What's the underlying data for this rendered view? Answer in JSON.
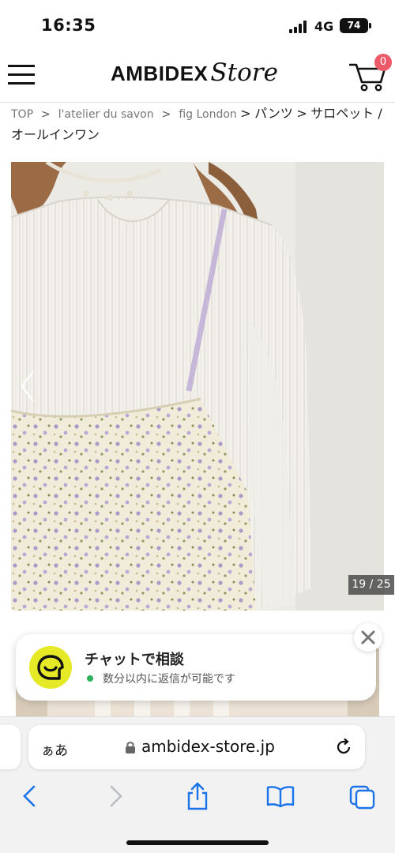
{
  "status_bar": {
    "time": "16:35",
    "network": "4G",
    "battery": "74"
  },
  "header": {
    "logo_main": "AMBIDEX",
    "logo_script": "Store",
    "cart_count": "0"
  },
  "breadcrumb": [
    {
      "label": "TOP"
    },
    {
      "label": "l'atelier du savon"
    },
    {
      "label": "fig London"
    },
    {
      "label": "パンツ"
    },
    {
      "label": "サロペット / オールインワン"
    }
  ],
  "gallery": {
    "counter": "19 / 25"
  },
  "chat_widget": {
    "title": "チャットで相談",
    "subtitle": "数分以内に返信が可能です"
  },
  "browser": {
    "aa_label": "ぁあ",
    "url": "ambidex-store.jp"
  },
  "colors": {
    "badge": "#ec5a6a",
    "chat_icon_bg": "#e6ea26",
    "online": "#2cb15a",
    "ios_blue": "#1a73e8"
  },
  "icons": [
    "menu-icon",
    "cart-icon",
    "chevron-left-icon",
    "chat-bubble-icon",
    "close-icon",
    "lock-icon",
    "reload-icon",
    "back-icon",
    "forward-icon",
    "share-icon",
    "bookmarks-icon",
    "tabs-icon"
  ]
}
